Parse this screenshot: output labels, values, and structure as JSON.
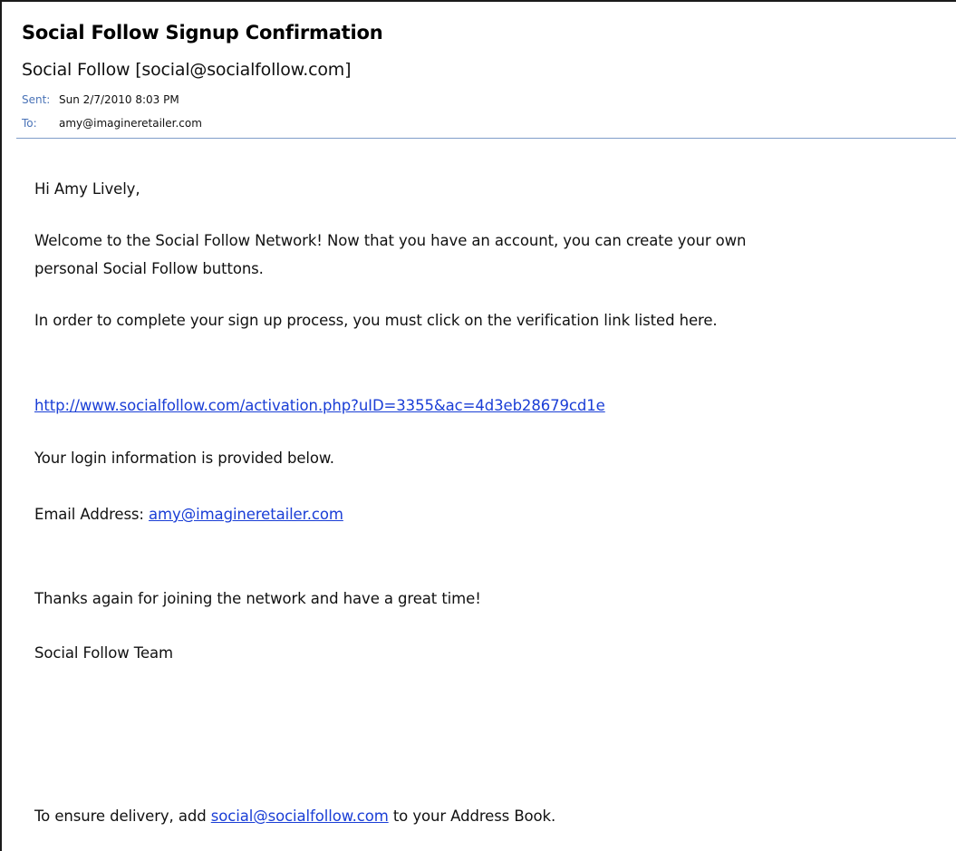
{
  "email": {
    "subject": "Social Follow Signup Confirmation",
    "from": "Social Follow [social@socialfollow.com]",
    "sent_label": "Sent:",
    "sent_value": "Sun 2/7/2010 8:03 PM",
    "to_label": "To:",
    "to_value": "amy@imagineretailer.com"
  },
  "body": {
    "greeting": "Hi Amy Lively,",
    "welcome_line1": "Welcome to the Social Follow Network! Now that you have an account, you can create your own",
    "welcome_line2": "personal Social Follow buttons.",
    "order_line": "In order to complete your sign up process, you must click on the verification link listed here.",
    "verification_link": "http://www.socialfollow.com/activation.php?uID=3355&ac=4d3eb28679cd1e",
    "login_info": "Your login information is provided below.",
    "email_label": "Email Address: ",
    "email_link": "amy@imagineretailer.com",
    "thanks": "Thanks again for joining the network and have a great time!",
    "signature": "Social Follow Team",
    "ensure_prefix": "To ensure delivery, add ",
    "ensure_link": "social@socialfollow.com",
    "ensure_suffix": " to your Address Book."
  },
  "colors": {
    "link": "#1a3ed6",
    "header_label": "#4a73b7",
    "divider": "#7f9dc9"
  }
}
